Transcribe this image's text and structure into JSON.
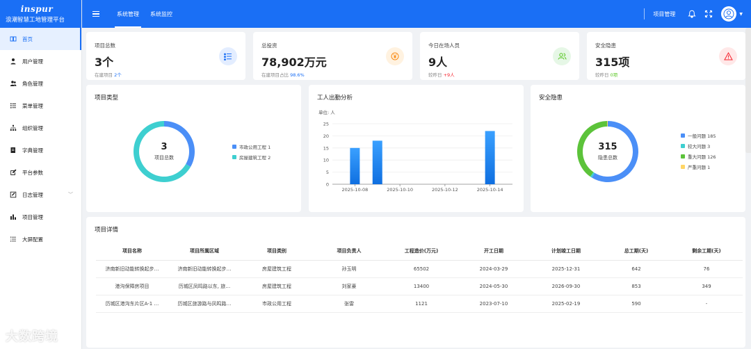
{
  "app": {
    "logo": "inspur",
    "name": "浪潮智慧工地管理平台"
  },
  "sidebar": {
    "items": [
      {
        "label": "首页",
        "icon": "book-icon"
      },
      {
        "label": "用户管理",
        "icon": "user-icon"
      },
      {
        "label": "角色管理",
        "icon": "users-icon"
      },
      {
        "label": "菜单管理",
        "icon": "list-icon"
      },
      {
        "label": "组织管理",
        "icon": "org-tree-icon"
      },
      {
        "label": "字典管理",
        "icon": "dictionary-icon"
      },
      {
        "label": "平台参数",
        "icon": "edit-icon"
      },
      {
        "label": "日志管理",
        "icon": "log-icon"
      },
      {
        "label": "项目管理",
        "icon": "bar-chart-icon"
      },
      {
        "label": "大屏配置",
        "icon": "settings-list-icon"
      }
    ]
  },
  "topbar": {
    "tabs": [
      "系统管理",
      "系统监控"
    ],
    "project_link": "项目管理"
  },
  "stats": [
    {
      "label": "项目总数",
      "value": "3个",
      "sub_prefix": "在建项目",
      "sub_value": "2个",
      "icon": "list-icon",
      "color": "#1a6ff5"
    },
    {
      "label": "总投资",
      "value": "78,902万元",
      "sub_prefix": "在建项目占比",
      "sub_value": "98.6%",
      "icon": "yen-icon",
      "color": "#fa8c16"
    },
    {
      "label": "今日在场人员",
      "value": "9人",
      "sub_prefix": "较昨日",
      "sub_value": "+9人",
      "icon": "people-icon",
      "color": "#52c41a"
    },
    {
      "label": "安全隐患",
      "value": "315项",
      "sub_prefix": "较昨日",
      "sub_value": "0项",
      "icon": "warning-icon",
      "color": "#f5222d"
    }
  ],
  "project_types": {
    "title": "项目类型",
    "total": "3",
    "total_label": "项目总数",
    "legend": [
      {
        "label": "市政公用工程 1",
        "color": "#4b8ff7"
      },
      {
        "label": "房屋建筑工程 2",
        "color": "#3ecfd0"
      }
    ]
  },
  "attendance": {
    "title": "工人出勤分析",
    "unit": "单位: 人"
  },
  "safety": {
    "title": "安全隐患",
    "total": "315",
    "total_label": "隐患总数",
    "legend": [
      {
        "label": "一般问题 185",
        "color": "#4b8ff7"
      },
      {
        "label": "较大问题 3",
        "color": "#3ecfd0"
      },
      {
        "label": "重大问题 126",
        "color": "#5cc33a"
      },
      {
        "label": "严重问题 1",
        "color": "#ffd666"
      }
    ]
  },
  "chart_data": [
    {
      "type": "pie",
      "title": "项目类型",
      "categories": [
        "市政公用工程",
        "房屋建筑工程"
      ],
      "values": [
        1,
        2
      ],
      "colors": [
        "#4b8ff7",
        "#3ecfd0"
      ]
    },
    {
      "type": "bar",
      "title": "工人出勤分析",
      "ylabel": "单位: 人",
      "x": [
        "2025-10-08",
        "2025-10-09",
        "2025-10-14"
      ],
      "x_ticks": [
        "2025-10-08",
        "2025-10-10",
        "2025-10-12",
        "2025-10-14"
      ],
      "x_range": [
        "2025-10-07",
        "2025-10-15"
      ],
      "values": [
        15,
        18,
        22
      ],
      "ylim": [
        0,
        25
      ],
      "y_ticks": [
        0,
        5,
        10,
        15,
        20,
        25
      ],
      "grid": true
    },
    {
      "type": "pie",
      "title": "安全隐患",
      "categories": [
        "一般问题",
        "较大问题",
        "重大问题",
        "严重问题"
      ],
      "values": [
        185,
        3,
        126,
        1
      ],
      "colors": [
        "#4b8ff7",
        "#3ecfd0",
        "#5cc33a",
        "#ffd666"
      ]
    }
  ],
  "details": {
    "title": "项目详情",
    "columns": [
      "项目名称",
      "项目所属区域",
      "项目类别",
      "项目负责人",
      "工程造价(万元)",
      "开工日期",
      "计划竣工日期",
      "总工期(天)",
      "剩余工期(天)"
    ],
    "rows": [
      [
        "济南新旧动能转换起步…",
        "济南新旧动能转换起步…",
        "房屋建筑工程",
        "孙玉明",
        "65502",
        "2024-03-29",
        "2025-12-31",
        "642",
        "76"
      ],
      [
        "港沟保障房项目",
        "历城区凤鸣路以东, 旅…",
        "房屋建筑工程",
        "刘家豪",
        "13400",
        "2024-05-30",
        "2026-09-30",
        "853",
        "349"
      ],
      [
        "历城区港沟东片区A-1 …",
        "历城区旅游路与凤鸣路…",
        "市政公用工程",
        "张雷",
        "1121",
        "2023-07-10",
        "2025-02-19",
        "590",
        "-"
      ]
    ]
  },
  "watermark": "大数跨境"
}
